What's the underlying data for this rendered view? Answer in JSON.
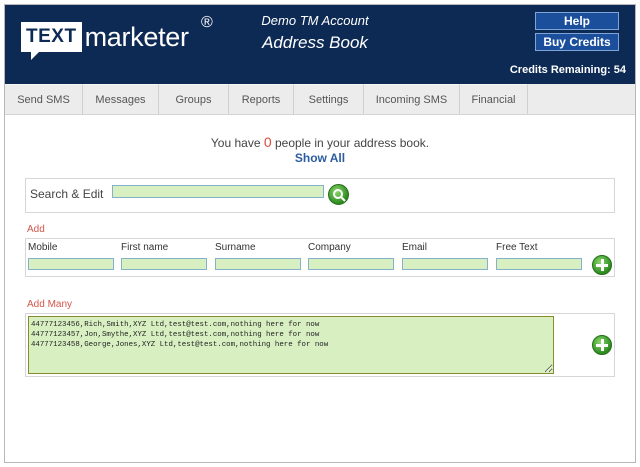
{
  "header": {
    "logo_box": "TEXT",
    "logo_word": "marketer",
    "logo_reg": "®",
    "account": "Demo TM Account",
    "page_title": "Address Book",
    "help_label": "Help",
    "buy_credits_label": "Buy Credits",
    "credits_text": "Credits Remaining: 54"
  },
  "nav": {
    "tabs": [
      {
        "label": "Send SMS"
      },
      {
        "label": "Messages"
      },
      {
        "label": "Groups"
      },
      {
        "label": "Reports"
      },
      {
        "label": "Settings"
      },
      {
        "label": "Incoming SMS"
      },
      {
        "label": "Financial"
      }
    ]
  },
  "summary": {
    "prefix": "You have ",
    "count": "0",
    "suffix": " people in your address book.",
    "show_all": "Show All"
  },
  "search": {
    "label": "Search & Edit",
    "value": "",
    "icon": "search-icon"
  },
  "add": {
    "section_label": "Add",
    "fields": [
      {
        "label": "Mobile",
        "value": ""
      },
      {
        "label": "First name",
        "value": ""
      },
      {
        "label": "Surname",
        "value": ""
      },
      {
        "label": "Company",
        "value": ""
      },
      {
        "label": "Email",
        "value": ""
      },
      {
        "label": "Free Text",
        "value": ""
      }
    ],
    "icon": "plus-icon"
  },
  "add_many": {
    "section_label": "Add Many",
    "text": "44777123456,Rich,Smith,XYZ Ltd,test@test.com,nothing here for now\n44777123457,Jon,Smythe,XYZ Ltd,test@test.com,nothing here for now\n44777123458,George,Jones,XYZ Ltd,test@test.com,nothing here for now",
    "icon": "plus-icon"
  },
  "colors": {
    "header_bg": "#0d2a55",
    "button_bg": "#1b4f9c",
    "input_bg": "#d8efc2",
    "accent_red": "#d94a3a",
    "link_blue": "#2c5d9e",
    "go_green": "#2d8a1f"
  }
}
